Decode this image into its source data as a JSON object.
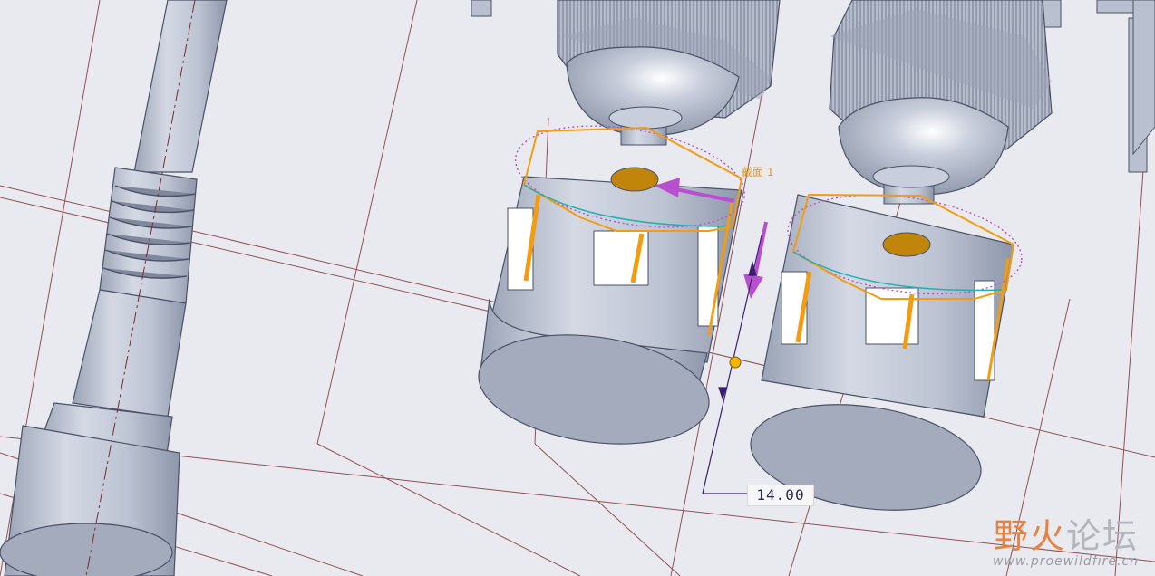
{
  "viewport": {
    "background": "#e9eaef",
    "part_color": "#c4cad8",
    "selection_color": "#f39c12",
    "highlight_color": "#b94fcf",
    "datum_color": "#7a2a30"
  },
  "dimension": {
    "value": "14.00"
  },
  "section_label": "截面 1",
  "watermark": {
    "title_part1": "野",
    "title_part2": "火",
    "title_part3": "论坛",
    "url": "www.proewildfire.cn"
  },
  "icons": {
    "drag_handle": "drag-handle-icon",
    "direction_arrow": "direction-arrow-icon"
  }
}
